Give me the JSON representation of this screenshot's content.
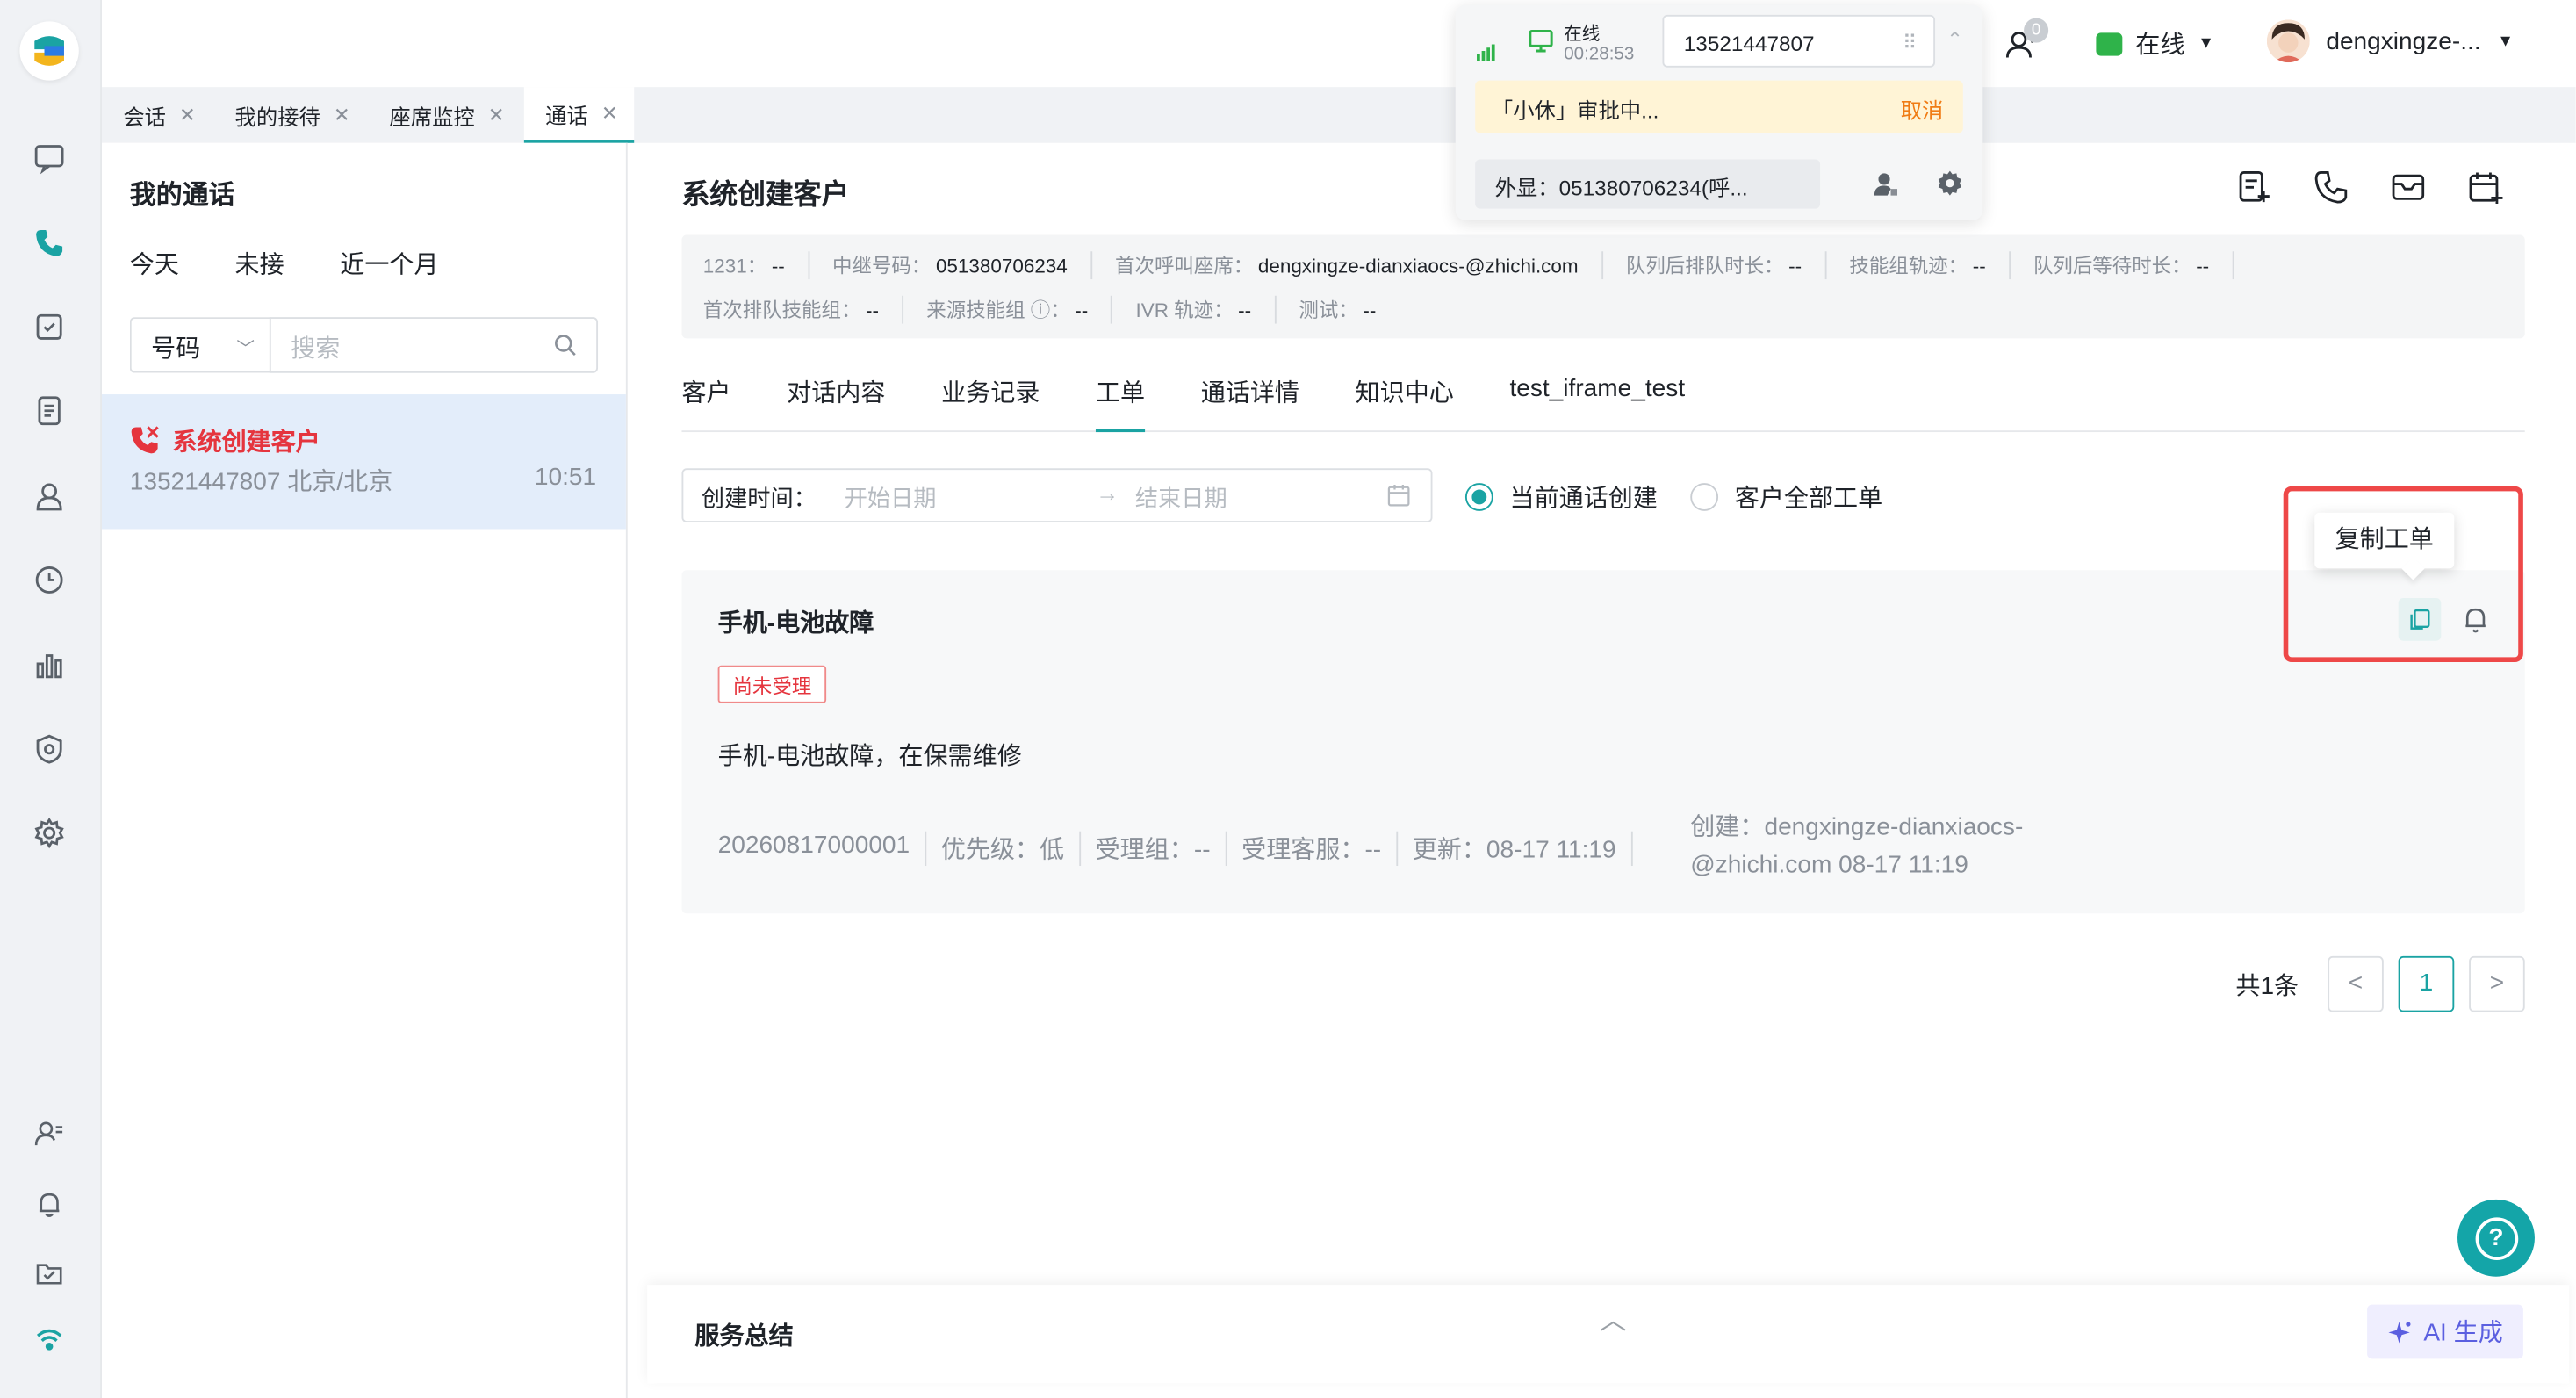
{
  "tabs": [
    {
      "label": "会话"
    },
    {
      "label": "我的接待"
    },
    {
      "label": "座席监控"
    },
    {
      "label": "通话"
    }
  ],
  "call_widget": {
    "status": "在线",
    "duration": "00:28:53",
    "number": "13521447807",
    "notice": "「小休」审批中...",
    "cancel_label": "取消",
    "outline": "外显：051380706234(呼..."
  },
  "header": {
    "notification_count": "0",
    "online_label": "在线",
    "username": "dengxingze-..."
  },
  "list_panel": {
    "title": "我的通话",
    "filters": [
      "今天",
      "未接",
      "近一个月"
    ],
    "select_value": "号码",
    "search_placeholder": "搜索",
    "items": [
      {
        "name": "系统创建客户",
        "phone": "13521447807 北京/北京",
        "time": "10:51"
      }
    ]
  },
  "main": {
    "title": "系统创建客户",
    "info": {
      "row1": [
        {
          "k": "1231：",
          "v": "--"
        },
        {
          "k": "中继号码：",
          "v": "051380706234"
        },
        {
          "k": "首次呼叫座席：",
          "v": "dengxingze-dianxiaocs-@zhichi.com"
        },
        {
          "k": "队列后排队时长：",
          "v": "--"
        },
        {
          "k": "技能组轨迹：",
          "v": "--"
        },
        {
          "k": "队列后等待时长：",
          "v": "--"
        }
      ],
      "row2": [
        {
          "k": "首次排队技能组：",
          "v": "--"
        },
        {
          "k": "来源技能组 ⓘ：",
          "v": "--"
        },
        {
          "k": "IVR 轨迹：",
          "v": "--"
        },
        {
          "k": "测试：",
          "v": "--"
        }
      ]
    },
    "tabs": [
      "客户",
      "对话内容",
      "业务记录",
      "工单",
      "通话详情",
      "知识中心",
      "test_iframe_test"
    ],
    "date_label": "创建时间：",
    "date_start": "开始日期",
    "date_end": "结束日期",
    "radio_current": "当前通话创建",
    "radio_all": "客户全部工单",
    "ticket": {
      "title": "手机-电池故障",
      "status": "尚未受理",
      "description": "手机-电池故障，在保需维修",
      "meta": [
        "20260817000001",
        "优先级：低",
        "受理组：--",
        "受理客服：--",
        "更新：08-17 11:19"
      ],
      "creator": "创建：dengxingze-dianxiaocs-@zhichi.com 08-17 11:19"
    },
    "tooltip": "复制工单",
    "pager_total": "共1条",
    "page_current": "1",
    "summary_title": "服务总结",
    "ai_label": "AI 生成"
  },
  "colors": {
    "accent": "#1aa3a3",
    "danger": "#e5353e",
    "highlight": "#ee4848"
  }
}
